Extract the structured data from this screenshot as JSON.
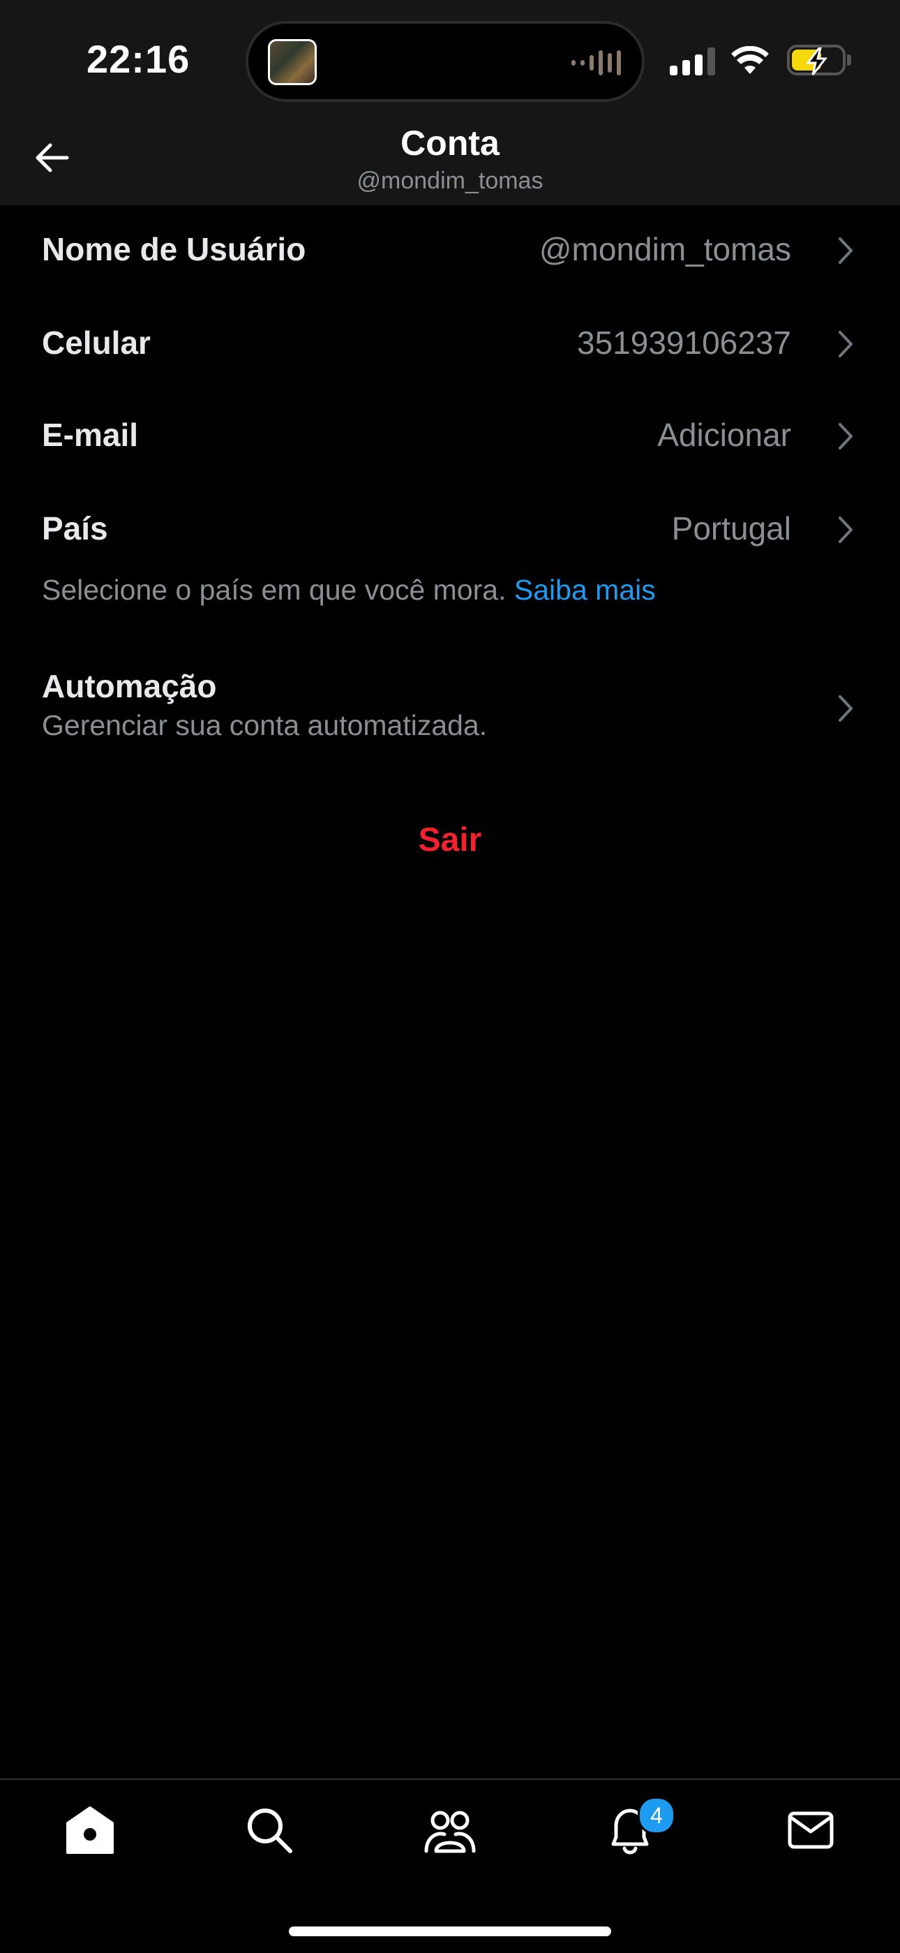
{
  "status_bar": {
    "time": "22:16"
  },
  "header": {
    "title": "Conta",
    "subtitle": "@mondim_tomas"
  },
  "rows": [
    {
      "label": "Nome de Usuário",
      "value": "@mondim_tomas"
    },
    {
      "label": "Celular",
      "value": "351939106237"
    },
    {
      "label": "E-mail",
      "value": "Adicionar"
    },
    {
      "label": "País",
      "value": "Portugal"
    }
  ],
  "country_note": {
    "text": "Selecione o país em que você mora.",
    "link": "Saiba mais"
  },
  "automation": {
    "label": "Automação",
    "description": "Gerenciar sua conta automatizada."
  },
  "logout_label": "Sair",
  "tabbar": {
    "items": [
      "home-icon",
      "search-icon",
      "communities-icon",
      "notifications-icon",
      "messages-icon"
    ],
    "notifications_badge": "4"
  },
  "colors": {
    "accent": "#1d9bf0",
    "danger": "#f4212e",
    "battery": "#f5d90a"
  }
}
